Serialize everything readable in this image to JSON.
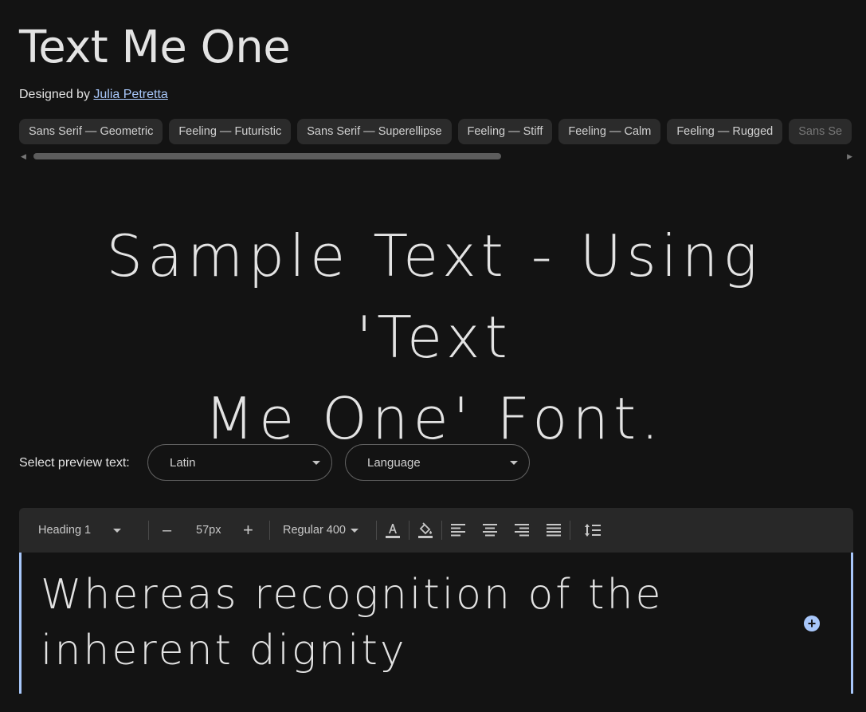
{
  "header": {
    "title": "Text Me One",
    "designed_by_label": "Designed by",
    "designer_name": "Julia Petretta"
  },
  "tags": [
    "Sans Serif — Geometric",
    "Feeling — Futuristic",
    "Sans Serif — Superellipse",
    "Feeling — Stiff",
    "Feeling — Calm",
    "Feeling — Rugged",
    "Sans Se"
  ],
  "sample": {
    "line1": "Sample Text - Using 'Text",
    "line2": "Me One' Font."
  },
  "preview": {
    "label": "Select preview text:",
    "script_value": "Latin",
    "language_value": "Language"
  },
  "toolbar": {
    "style_value": "Heading 1",
    "decrease_label": "–",
    "size_value": "57px",
    "increase_label": "+",
    "weight_value": "Regular 400"
  },
  "editor": {
    "text": "Whereas recognition of the inherent dignity"
  },
  "colors": {
    "background": "#131313",
    "accent": "#a8c7fa",
    "chip": "#2b2b2b",
    "toolbar": "#282828"
  },
  "icons": {
    "text_color": "text-color-icon",
    "highlight": "highlight-color-icon",
    "align_left": "align-left-icon",
    "align_center": "align-center-icon",
    "align_right": "align-right-icon",
    "align_justify": "align-justify-icon",
    "line_height": "line-height-icon",
    "add": "add-circle-icon"
  }
}
